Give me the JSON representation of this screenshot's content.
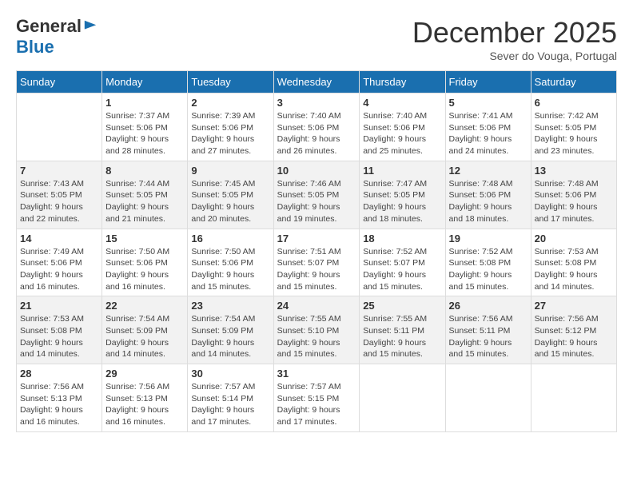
{
  "logo": {
    "general": "General",
    "blue": "Blue"
  },
  "header": {
    "month": "December 2025",
    "location": "Sever do Vouga, Portugal"
  },
  "days_of_week": [
    "Sunday",
    "Monday",
    "Tuesday",
    "Wednesday",
    "Thursday",
    "Friday",
    "Saturday"
  ],
  "weeks": [
    [
      {
        "day": "",
        "info": ""
      },
      {
        "day": "1",
        "info": "Sunrise: 7:37 AM\nSunset: 5:06 PM\nDaylight: 9 hours\nand 28 minutes."
      },
      {
        "day": "2",
        "info": "Sunrise: 7:39 AM\nSunset: 5:06 PM\nDaylight: 9 hours\nand 27 minutes."
      },
      {
        "day": "3",
        "info": "Sunrise: 7:40 AM\nSunset: 5:06 PM\nDaylight: 9 hours\nand 26 minutes."
      },
      {
        "day": "4",
        "info": "Sunrise: 7:40 AM\nSunset: 5:06 PM\nDaylight: 9 hours\nand 25 minutes."
      },
      {
        "day": "5",
        "info": "Sunrise: 7:41 AM\nSunset: 5:06 PM\nDaylight: 9 hours\nand 24 minutes."
      },
      {
        "day": "6",
        "info": "Sunrise: 7:42 AM\nSunset: 5:05 PM\nDaylight: 9 hours\nand 23 minutes."
      }
    ],
    [
      {
        "day": "7",
        "info": "Sunrise: 7:43 AM\nSunset: 5:05 PM\nDaylight: 9 hours\nand 22 minutes."
      },
      {
        "day": "8",
        "info": "Sunrise: 7:44 AM\nSunset: 5:05 PM\nDaylight: 9 hours\nand 21 minutes."
      },
      {
        "day": "9",
        "info": "Sunrise: 7:45 AM\nSunset: 5:05 PM\nDaylight: 9 hours\nand 20 minutes."
      },
      {
        "day": "10",
        "info": "Sunrise: 7:46 AM\nSunset: 5:05 PM\nDaylight: 9 hours\nand 19 minutes."
      },
      {
        "day": "11",
        "info": "Sunrise: 7:47 AM\nSunset: 5:05 PM\nDaylight: 9 hours\nand 18 minutes."
      },
      {
        "day": "12",
        "info": "Sunrise: 7:48 AM\nSunset: 5:06 PM\nDaylight: 9 hours\nand 18 minutes."
      },
      {
        "day": "13",
        "info": "Sunrise: 7:48 AM\nSunset: 5:06 PM\nDaylight: 9 hours\nand 17 minutes."
      }
    ],
    [
      {
        "day": "14",
        "info": "Sunrise: 7:49 AM\nSunset: 5:06 PM\nDaylight: 9 hours\nand 16 minutes."
      },
      {
        "day": "15",
        "info": "Sunrise: 7:50 AM\nSunset: 5:06 PM\nDaylight: 9 hours\nand 16 minutes."
      },
      {
        "day": "16",
        "info": "Sunrise: 7:50 AM\nSunset: 5:06 PM\nDaylight: 9 hours\nand 15 minutes."
      },
      {
        "day": "17",
        "info": "Sunrise: 7:51 AM\nSunset: 5:07 PM\nDaylight: 9 hours\nand 15 minutes."
      },
      {
        "day": "18",
        "info": "Sunrise: 7:52 AM\nSunset: 5:07 PM\nDaylight: 9 hours\nand 15 minutes."
      },
      {
        "day": "19",
        "info": "Sunrise: 7:52 AM\nSunset: 5:08 PM\nDaylight: 9 hours\nand 15 minutes."
      },
      {
        "day": "20",
        "info": "Sunrise: 7:53 AM\nSunset: 5:08 PM\nDaylight: 9 hours\nand 14 minutes."
      }
    ],
    [
      {
        "day": "21",
        "info": "Sunrise: 7:53 AM\nSunset: 5:08 PM\nDaylight: 9 hours\nand 14 minutes."
      },
      {
        "day": "22",
        "info": "Sunrise: 7:54 AM\nSunset: 5:09 PM\nDaylight: 9 hours\nand 14 minutes."
      },
      {
        "day": "23",
        "info": "Sunrise: 7:54 AM\nSunset: 5:09 PM\nDaylight: 9 hours\nand 14 minutes."
      },
      {
        "day": "24",
        "info": "Sunrise: 7:55 AM\nSunset: 5:10 PM\nDaylight: 9 hours\nand 15 minutes."
      },
      {
        "day": "25",
        "info": "Sunrise: 7:55 AM\nSunset: 5:11 PM\nDaylight: 9 hours\nand 15 minutes."
      },
      {
        "day": "26",
        "info": "Sunrise: 7:56 AM\nSunset: 5:11 PM\nDaylight: 9 hours\nand 15 minutes."
      },
      {
        "day": "27",
        "info": "Sunrise: 7:56 AM\nSunset: 5:12 PM\nDaylight: 9 hours\nand 15 minutes."
      }
    ],
    [
      {
        "day": "28",
        "info": "Sunrise: 7:56 AM\nSunset: 5:13 PM\nDaylight: 9 hours\nand 16 minutes."
      },
      {
        "day": "29",
        "info": "Sunrise: 7:56 AM\nSunset: 5:13 PM\nDaylight: 9 hours\nand 16 minutes."
      },
      {
        "day": "30",
        "info": "Sunrise: 7:57 AM\nSunset: 5:14 PM\nDaylight: 9 hours\nand 17 minutes."
      },
      {
        "day": "31",
        "info": "Sunrise: 7:57 AM\nSunset: 5:15 PM\nDaylight: 9 hours\nand 17 minutes."
      },
      {
        "day": "",
        "info": ""
      },
      {
        "day": "",
        "info": ""
      },
      {
        "day": "",
        "info": ""
      }
    ]
  ]
}
